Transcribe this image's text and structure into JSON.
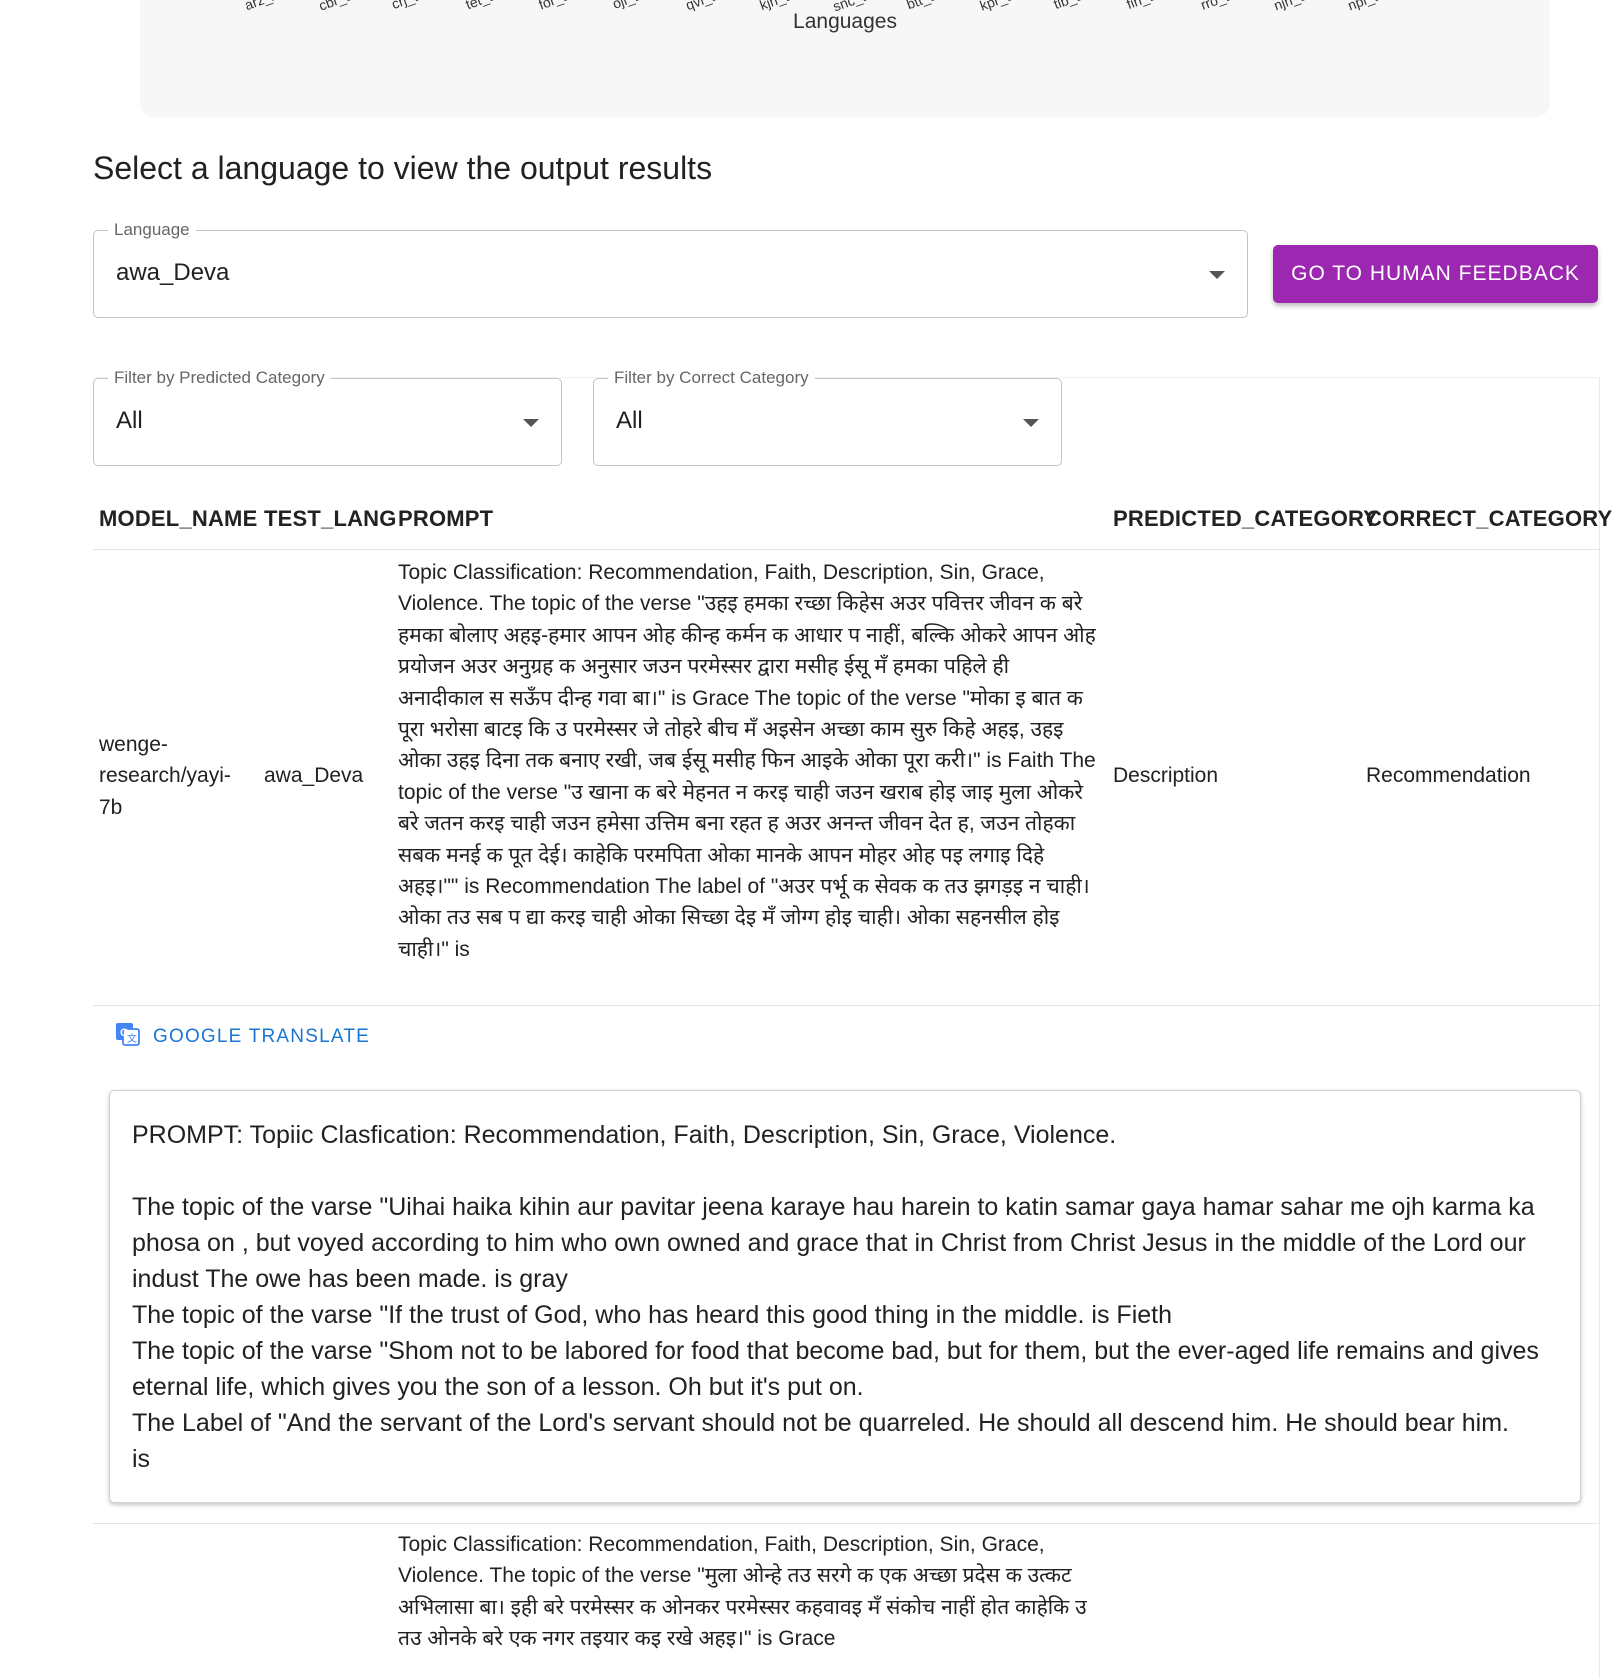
{
  "chart": {
    "tick_labels": [
      "arz_Ar",
      "cbr_La",
      "crj_La",
      "tet_La",
      "for_La",
      "oji_La",
      "qvi_La",
      "kjn_La",
      "snc_La",
      "btt_La",
      "kpr_La",
      "tlb_La",
      "fin_La",
      "rro_La",
      "njn_La",
      "npl_La"
    ],
    "x_axis_title": "Languages"
  },
  "section_title": "Select a language to view the output results",
  "language_select": {
    "label": "Language",
    "value": "awa_Deva"
  },
  "human_feedback_button": "GO TO HUMAN FEEDBACK",
  "filters": {
    "predicted": {
      "label": "Filter by Predicted Category",
      "value": "All"
    },
    "correct": {
      "label": "Filter by Correct Category",
      "value": "All"
    }
  },
  "table": {
    "headers": [
      "MODEL_NAME",
      "TEST_LANG",
      "PROMPT",
      "PREDICTED_CATEGORY",
      "CORRECT_CATEGORY"
    ],
    "row1": {
      "model_name": "wenge-research/yayi-7b",
      "test_lang": "awa_Deva",
      "prompt": "Topic Classification: Recommendation, Faith, Description, Sin, Grace, Violence. The topic of the verse \"उहइ हमका रच्छा किहेस अउर पवित्तर जीवन क बरे हमका बोलाए अहइ-हमार आपन ओह कीन्ह कर्मन क आधार प नाहीं, बल्कि ओकरे आपन ओह प्रयोजन अउर अनुग्रह क अनुसार जउन परमेस्सर द्वारा मसीह ईसू मँ हमका पहिले ही अनादीकाल स सऊँप दीन्ह गवा बा।\" is Grace The topic of the verse \"मोका इ बात क पूरा भरोसा बाटइ कि उ परमेस्सर जे तोहरे बीच मँ अइसेन अच्छा काम सुरु किहे अहइ, उहइ ओका उहइ दिना तक बनाए रखी, जब ईसू मसीह फिन आइके ओका पूरा करी।\" is Faith The topic of the verse \"उ खाना क बरे मेहनत न करइ चाही जउन खराब होइ जाइ मुला ओकरे बरे जतन करइ चाही जउन हमेसा उत्तिम बना रहत ह अउर अनन्त जीवन देत ह, जउन तोहका सबक मनई क पूत देई। काहेकि परमपिता ओका मानके आपन मोहर ओह पइ लगाइ दिहे अहइ।\"\" is Recommendation The label of \"अउर पर्भू क सेवक क तउ झगड़इ न चाही। ओका तउ सब प द्या करइ चाही ओका सिच्छा देइ मँ जोग्ग होइ चाही। ओका सहनसील होइ चाही।\" is",
      "predicted_category": "Description",
      "correct_category": "Recommendation"
    },
    "translate_label": "GOOGLE TRANSLATE",
    "translation": "PROMPT: Topiic Clasfication: Recommendation, Faith, Description, Sin, Grace, Violence.\n\nThe topic of the varse \"Uihai haika kihin aur pavitar jeena karaye hau harein to katin samar gaya hamar sahar me ojh karma ka phosa on , but voyed according to him who own owned and grace that in Christ from Christ Jesus in the middle of the Lord our indust The owe has been made. is gray\nThe topic of the varse \"If the trust of God, who has heard this good thing in the middle. is Fieth\nThe topic of the varse \"Shom not to be labored for food that become bad, but for them, but the ever-aged life remains and gives eternal life, which gives you the son of a lesson. Oh but it's put on.\nThe Label of \"And the servant of the Lord's servant should not be quarreled. He should all descend him. He should bear him.\nis",
    "row2": {
      "prompt": "Topic Classification: Recommendation, Faith, Description, Sin, Grace, Violence. The topic of the verse \"मुला ओन्हे तउ सरगे क एक अच्छा प्रदेस क उत्कट अभिलासा बा। इही बरे परमेस्सर क ओनकर परमेस्सर कहवावइ मँ संकोच नाहीं होत काहेकि उ तउ ओनके बरे एक नगर तइयार कइ रखे अहइ।\" is Grace"
    }
  }
}
